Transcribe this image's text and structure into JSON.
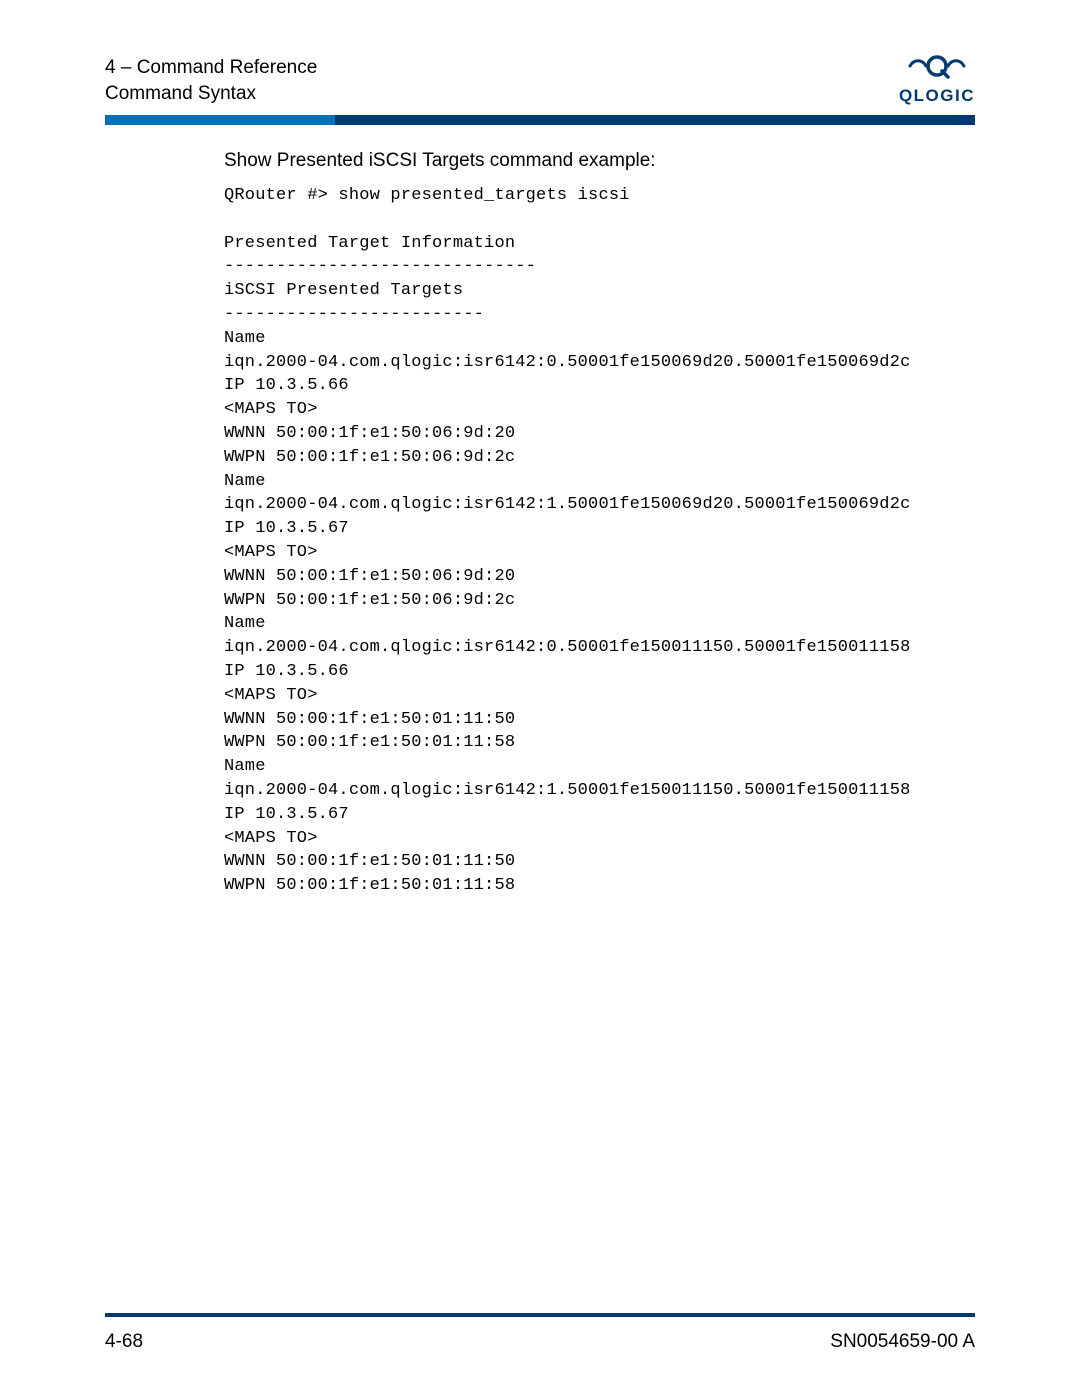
{
  "header": {
    "chapter_line": "4 – Command Reference",
    "section_line": "Command Syntax",
    "logo_wordmark": "QLOGIC"
  },
  "body": {
    "section_title": "Show Presented iSCSI Targets command example:",
    "code": "QRouter #> show presented_targets iscsi\n\nPresented Target Information\n------------------------------\niSCSI Presented Targets\n-------------------------\nName\niqn.2000-04.com.qlogic:isr6142:0.50001fe150069d20.50001fe150069d2c\nIP 10.3.5.66\n<MAPS TO>\nWWNN 50:00:1f:e1:50:06:9d:20\nWWPN 50:00:1f:e1:50:06:9d:2c\nName\niqn.2000-04.com.qlogic:isr6142:1.50001fe150069d20.50001fe150069d2c\nIP 10.3.5.67\n<MAPS TO>\nWWNN 50:00:1f:e1:50:06:9d:20\nWWPN 50:00:1f:e1:50:06:9d:2c\nName\niqn.2000-04.com.qlogic:isr6142:0.50001fe150011150.50001fe150011158\nIP 10.3.5.66\n<MAPS TO>\nWWNN 50:00:1f:e1:50:01:11:50\nWWPN 50:00:1f:e1:50:01:11:58\nName\niqn.2000-04.com.qlogic:isr6142:1.50001fe150011150.50001fe150011158\nIP 10.3.5.67\n<MAPS TO>\nWWNN 50:00:1f:e1:50:01:11:50\nWWPN 50:00:1f:e1:50:01:11:58"
  },
  "footer": {
    "page_number": "4-68",
    "doc_id": "SN0054659-00 A"
  }
}
